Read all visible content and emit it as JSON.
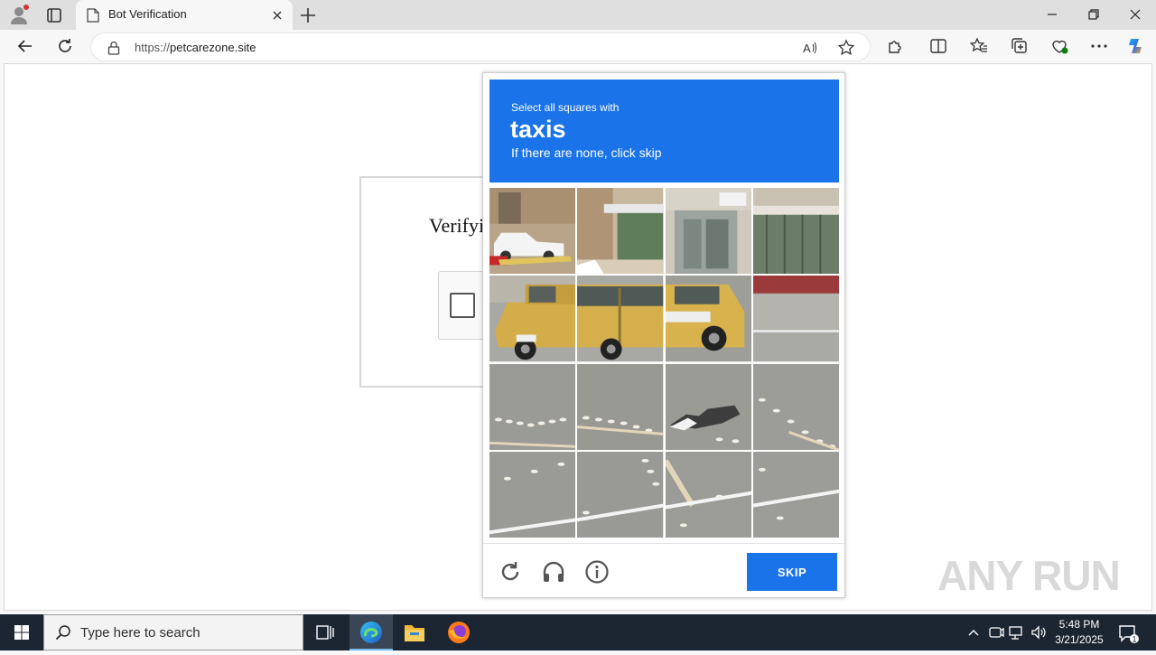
{
  "browser": {
    "tab_title": "Bot Verification",
    "url_prefix": "https://",
    "url_host": "petcarezone.site"
  },
  "page": {
    "verify_title": "Verifyi"
  },
  "challenge": {
    "instruction": "Select all squares with",
    "target": "taxis",
    "hint": "If there are none, click skip",
    "skip_label": "SKIP",
    "icons": [
      "reload-icon",
      "audio-challenge-icon",
      "info-icon"
    ],
    "header_color": "#1a73e8"
  },
  "watermark": "ANY RUN",
  "taskbar": {
    "search_placeholder": "Type here to search",
    "time": "5:48 PM",
    "date": "3/21/2025",
    "notification_count": "1",
    "apps": [
      "task-view",
      "edge",
      "file-explorer",
      "firefox"
    ]
  }
}
